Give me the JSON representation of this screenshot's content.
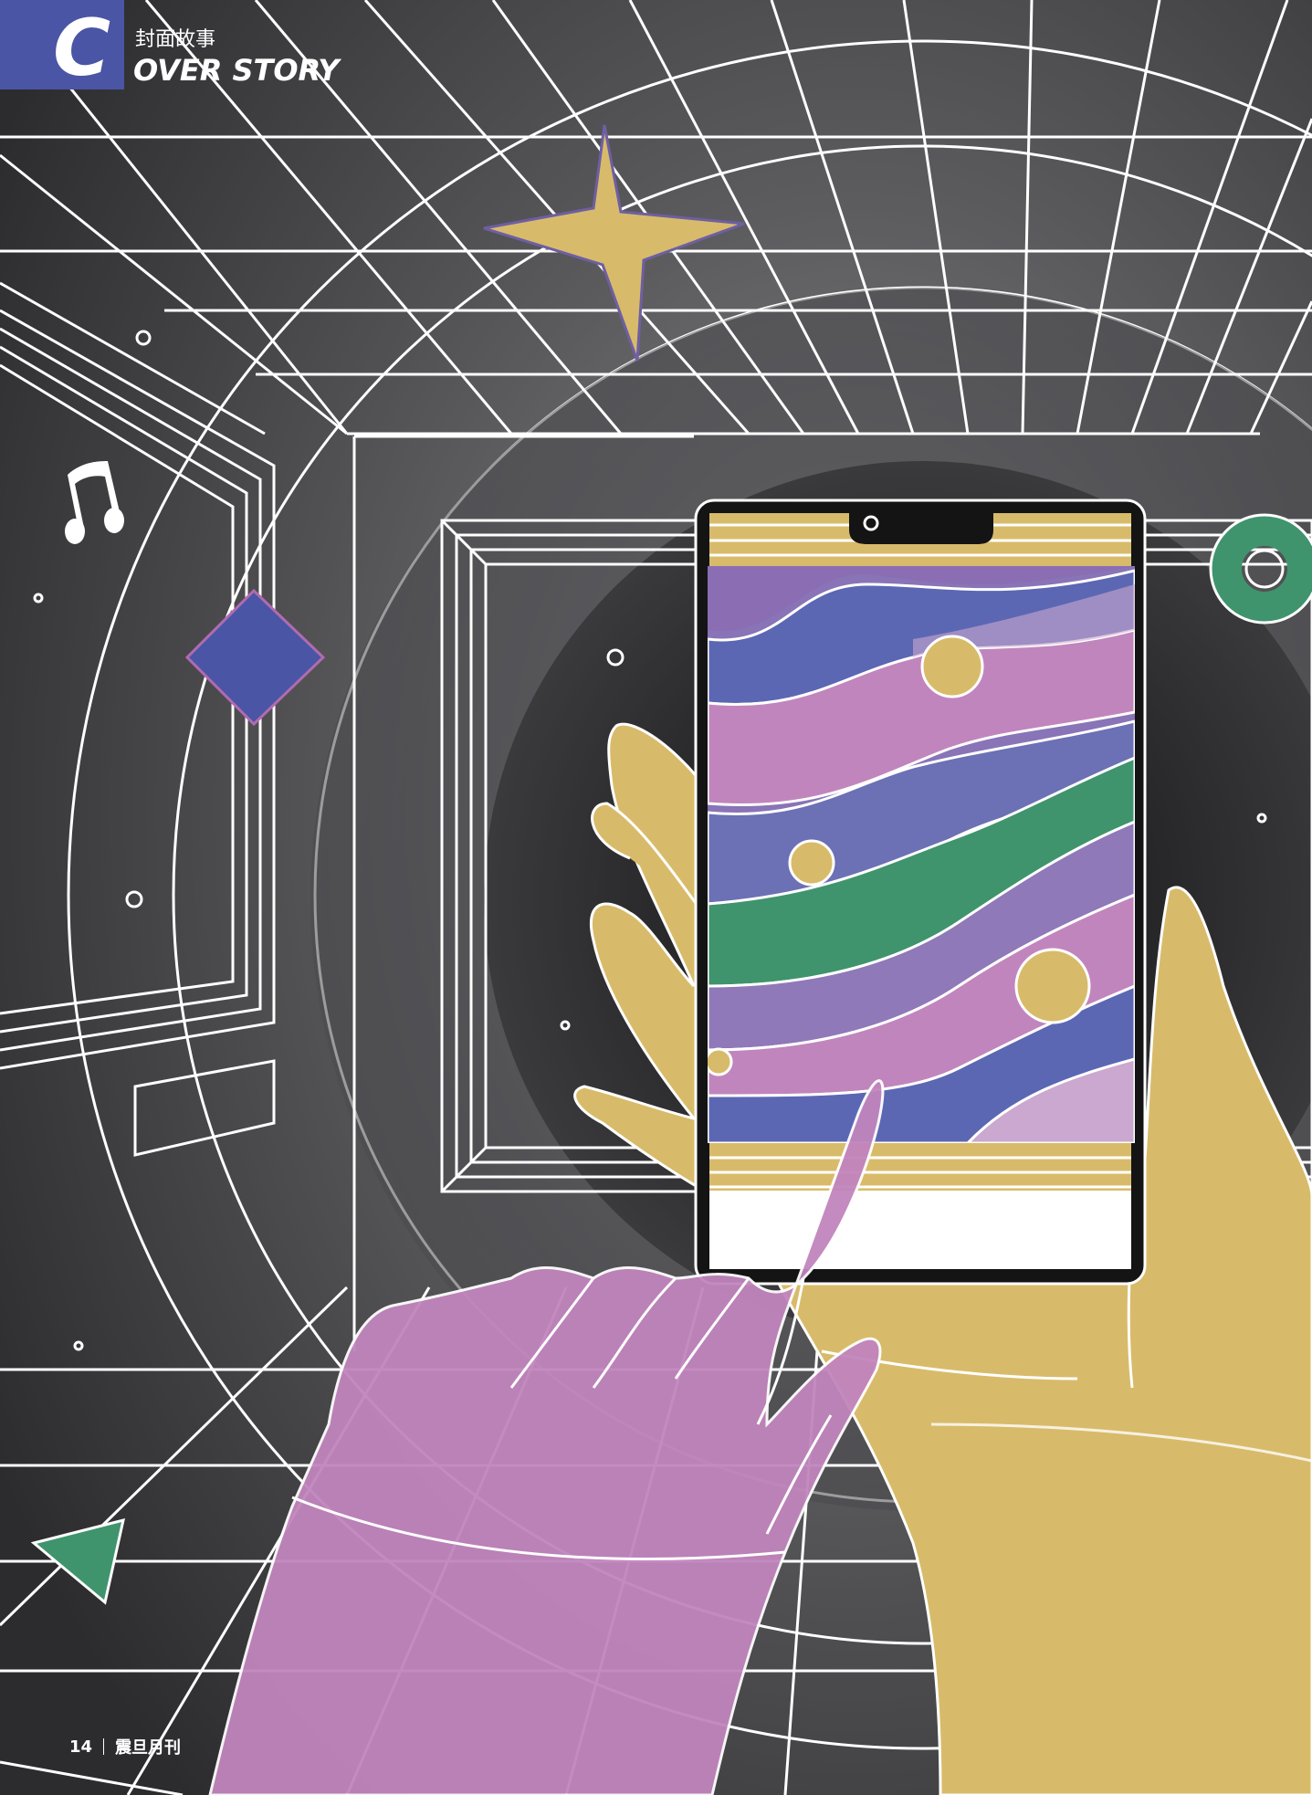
{
  "header": {
    "section_letter": "C",
    "section_title_cn": "封面故事",
    "section_title_en": "OVER STORY"
  },
  "footer": {
    "page_number": "14",
    "publication": "震旦月刊"
  },
  "colors": {
    "badge": "#4a55a5",
    "background": "#3a3a3c",
    "line": "#ffffff",
    "yellow": "#d8bb6a",
    "pink": "#c185bd",
    "blue": "#4a55a5",
    "green": "#3f946d",
    "lavender": "#cba8cf"
  },
  "icons": [
    "music-note-icon",
    "four-point-star-icon",
    "diamond-icon",
    "ring-icon",
    "triangle-icon"
  ]
}
